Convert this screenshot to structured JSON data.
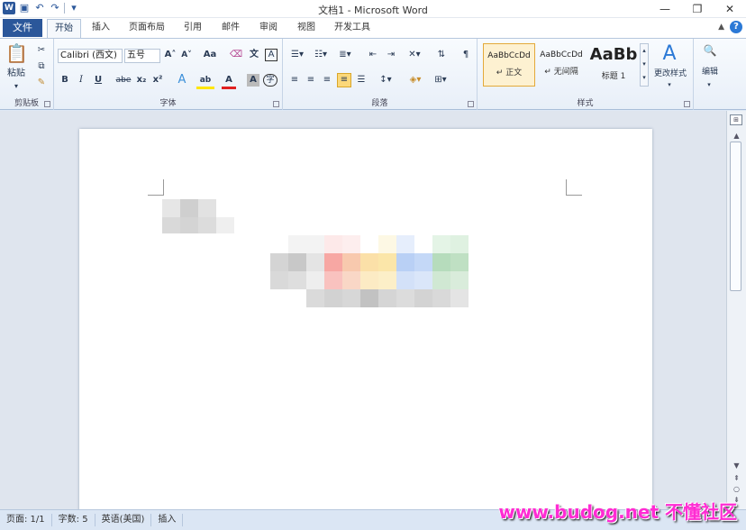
{
  "titlebar": {
    "title": "文档1 - Microsoft Word",
    "app_icon": "W",
    "qat": {
      "save_icon": "save-icon",
      "undo_icon": "undo-icon",
      "redo_icon": "redo-icon",
      "customize": "▾"
    },
    "controls": {
      "minimize": "—",
      "restore": "❐",
      "close": "✕"
    }
  },
  "tabs": {
    "file": "文件",
    "items": [
      "开始",
      "插入",
      "页面布局",
      "引用",
      "邮件",
      "审阅",
      "视图",
      "开发工具"
    ],
    "active": "开始",
    "help": "?"
  },
  "ribbon": {
    "clipboard": {
      "label": "剪贴板",
      "paste": "粘贴"
    },
    "font": {
      "label": "字体",
      "font_name": "Calibri (西文)",
      "font_size": "五号",
      "grow": "A˄",
      "shrink": "A˅",
      "case": "Aa",
      "clear": "⌫",
      "phonetic": "文",
      "border": "A",
      "bold": "B",
      "italic": "I",
      "underline": "U",
      "strike": "abe",
      "subscript": "x₂",
      "superscript": "x²",
      "effects": "A",
      "highlight": "ab",
      "color": "A",
      "shade": "A",
      "enclose": "字"
    },
    "paragraph": {
      "label": "段落"
    },
    "styles": {
      "label": "样式",
      "items": [
        {
          "sample": "AaBbCcDd",
          "name": "↵ 正文",
          "selected": true
        },
        {
          "sample": "AaBbCcDd",
          "name": "↵ 无间隔",
          "selected": false
        },
        {
          "sample": "AaBb",
          "name": "标题 1",
          "selected": false
        }
      ],
      "change_styles": "更改样式"
    },
    "editing": {
      "label": "编辑"
    }
  },
  "statusbar": {
    "page": "页面: 1/1",
    "words": "字数: 5",
    "language": "英语(美国)",
    "mode": "插入"
  },
  "watermark": "www.budog.net 不懂社区",
  "colors": {
    "accent": "#2b579a",
    "style_selected": "#fdf1d1"
  }
}
